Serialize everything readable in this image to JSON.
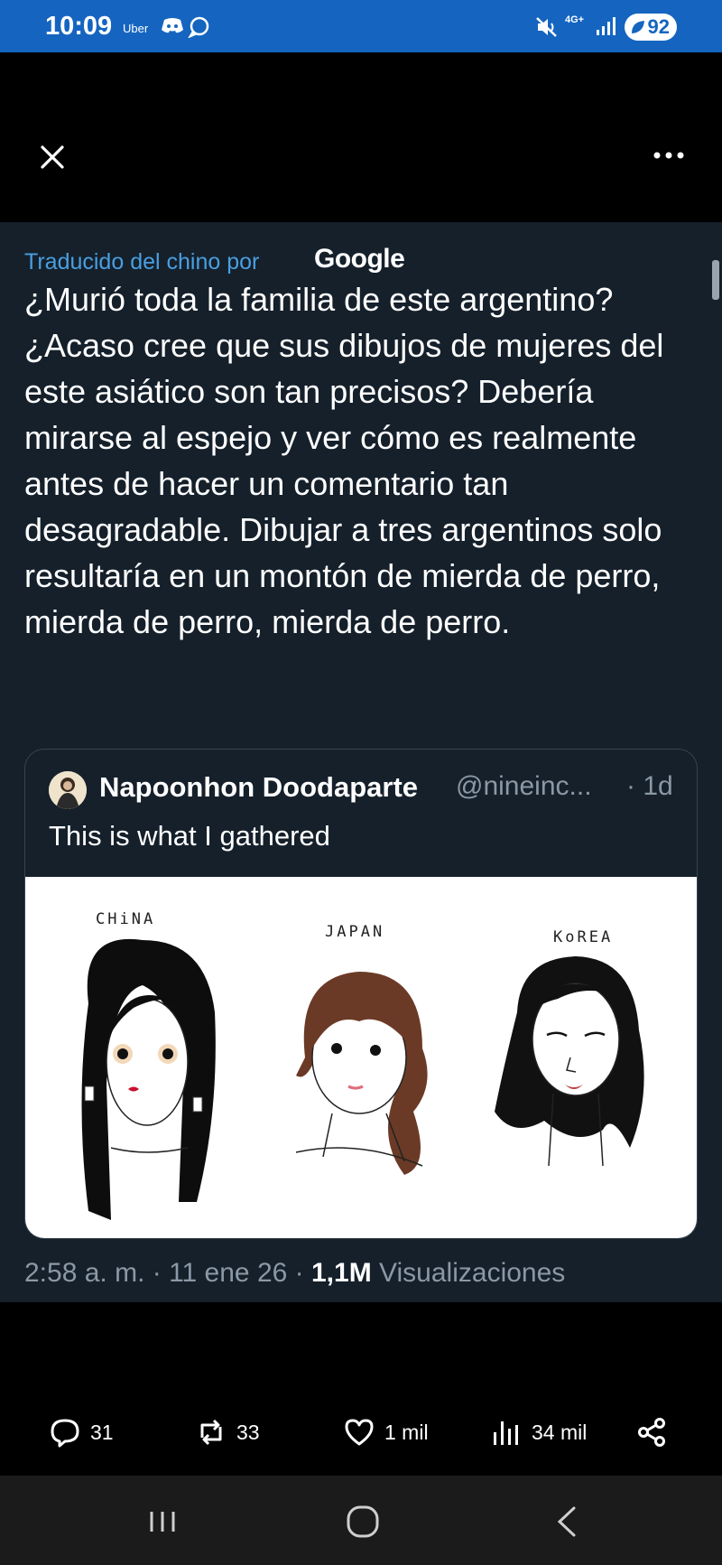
{
  "status_bar": {
    "time": "10:09",
    "uber_label": "Uber",
    "network": "4G+",
    "battery": "92"
  },
  "header": {
    "close_icon": "close-icon",
    "more_icon": "more-icon"
  },
  "tweet": {
    "translated_label": "Traducido del chino por",
    "translator": "Google",
    "text": "¿Murió toda la familia de este argentino? ¿Acaso cree que sus dibujos de mujeres del este asiático son tan precisos? Debería mirarse al espejo y ver cómo es realmente antes de hacer un comentario tan desagradable. Dibujar a tres argentinos solo resultaría en un montón de mierda de perro, mierda de perro, mierda de perro.",
    "time": "2:58 a. m.",
    "date": "11 ene 26",
    "views_count": "1,1M",
    "views_label": "Visualizaciones"
  },
  "quote": {
    "name": "Napoonhon Doodaparte",
    "handle": "@nineinc...",
    "age": "· 1d",
    "text": "This is what I gathered",
    "image_labels": [
      "CHiNA",
      "JAPAN",
      "KoREA"
    ]
  },
  "actions": {
    "replies": "31",
    "reposts": "33",
    "likes": "1 mil",
    "views": "34 mil"
  },
  "colors": {
    "status_bar": "#1565c0",
    "background": "#15202b",
    "link": "#4a9fe0",
    "muted": "#8b98a5"
  }
}
